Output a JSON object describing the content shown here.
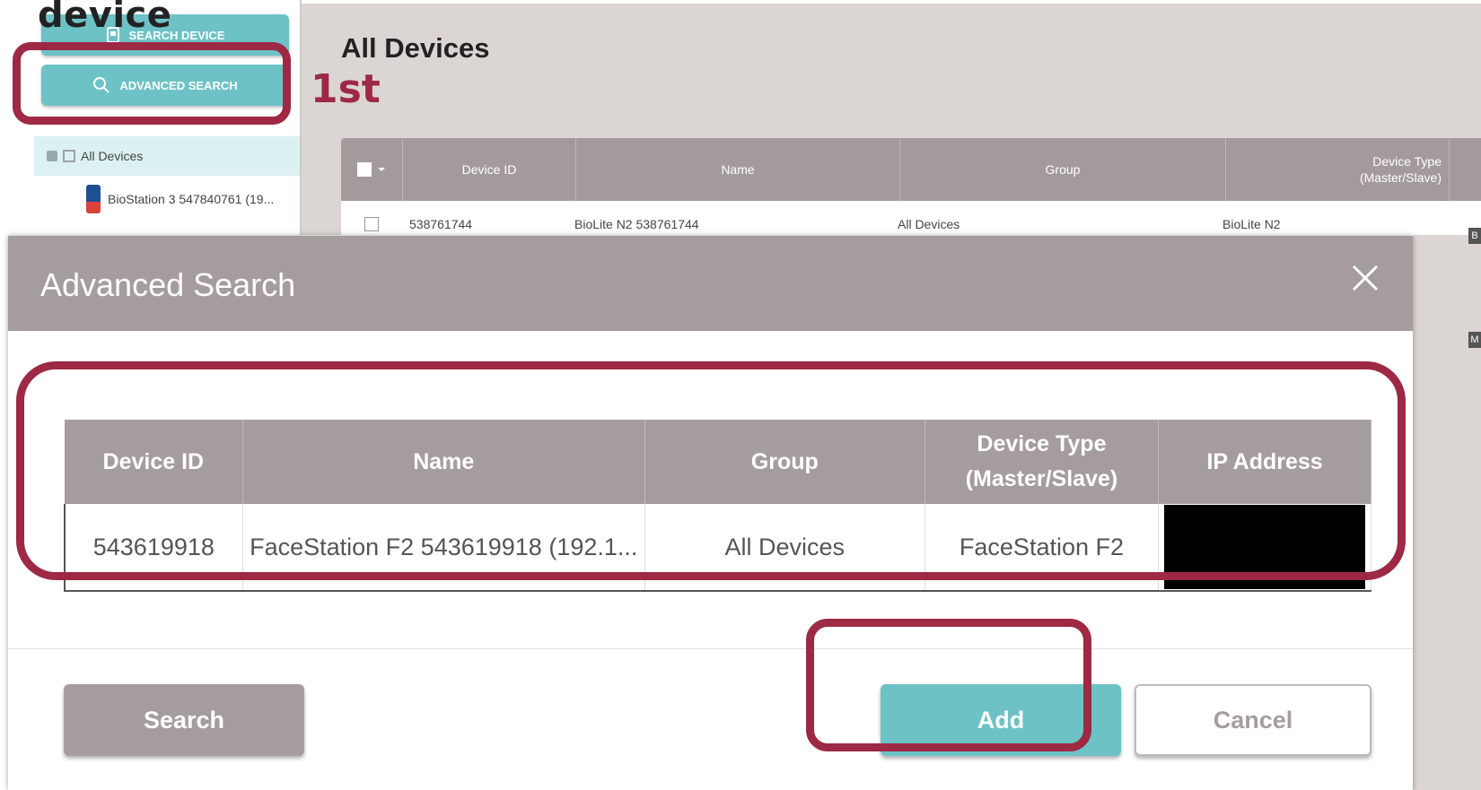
{
  "annotation": {
    "top_label": "device",
    "step_label": "1st",
    "color": "#9d2945"
  },
  "sidebar": {
    "search_device_label": "SEARCH DEVICE",
    "advanced_search_label": "ADVANCED SEARCH",
    "tree_root": "All Devices",
    "tree_child": "BioStation 3 547840761 (19..."
  },
  "main": {
    "title": "All Devices",
    "columns": [
      "Device ID",
      "Name",
      "Group",
      "Device Type\n(Master/Slave)"
    ],
    "row": {
      "device_id": "538761744",
      "name": "BioLite N2 538761744",
      "group": "All Devices",
      "device_type": "BioLite N2"
    },
    "edge_marks": [
      "B",
      "M"
    ]
  },
  "modal": {
    "title": "Advanced Search",
    "columns": [
      "Device ID",
      "Name",
      "Group",
      "Device Type\n(Master/Slave)",
      "IP Address"
    ],
    "rows": [
      {
        "device_id": "543619918",
        "name": "FaceStation F2 543619918 (192.1...",
        "group": "All Devices",
        "device_type": "FaceStation F2",
        "ip_address": ""
      }
    ],
    "search_label": "Search",
    "add_label": "Add",
    "cancel_label": "Cancel"
  },
  "colors": {
    "teal": "#6dc2c6",
    "header_gray": "#a59c9e",
    "annotation": "#9d2945"
  }
}
